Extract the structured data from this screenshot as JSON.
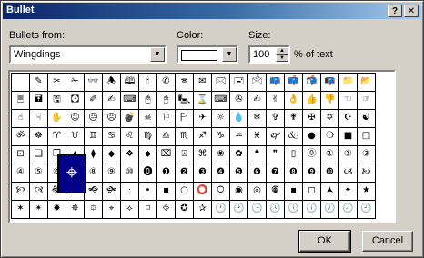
{
  "window": {
    "title": "Bullet",
    "help_label": "?",
    "close_label": "✕"
  },
  "bullets_from": {
    "label": "Bullets from:",
    "value": "Wingdings"
  },
  "color": {
    "label": "Color:"
  },
  "size": {
    "label": "Size:",
    "value": "100",
    "suffix": "% of text"
  },
  "grid": {
    "selected_symbol": "⌖",
    "rows": [
      [
        "",
        "✎",
        "✂",
        "✁",
        "👓",
        "🕭",
        "🕮",
        "🕯",
        "✆",
        "🕿",
        "✉",
        "🖂",
        "🖃",
        "🖄",
        "📪",
        "📫",
        "📬",
        "📭",
        "📁",
        "📂"
      ],
      [
        "🗏",
        "🖬",
        "🖫",
        "🖸",
        "✐",
        "✍",
        "⌨",
        "🖱",
        "🖰",
        "🖳",
        "⌛",
        "⌨",
        "✇",
        "✍",
        "✌",
        "👌",
        "👍",
        "👎",
        "☜",
        "☞"
      ],
      [
        "☝",
        "☟",
        "✋",
        "☺",
        "😐",
        "☹",
        "💣",
        "☠",
        "⚐",
        "🏱",
        "✈",
        "☼",
        "💧",
        "❄",
        "✞",
        "✟",
        "✠",
        "✡",
        "☪",
        "☯"
      ],
      [
        "ॐ",
        "☸",
        "♈",
        "♉",
        "♊",
        "♋",
        "♌",
        "♍",
        "♎",
        "♏",
        "♐",
        "♑",
        "♒",
        "♓",
        "🙰",
        "🙵",
        "●",
        "❍",
        "■",
        "□"
      ],
      [
        "⊡",
        "❑",
        "❒",
        "⬧",
        "⧫",
        "◆",
        "❖",
        "⬥",
        "⌧",
        "⍓",
        "⌘",
        "❀",
        "✿",
        "❝",
        "❞",
        "▯",
        "⓪",
        "①",
        "②",
        "③"
      ],
      [
        "④",
        "⑤",
        "⑥",
        "⑦",
        "⑧",
        "⑨",
        "⑩",
        "⓿",
        "❶",
        "❷",
        "❸",
        "❹",
        "❺",
        "❻",
        "❼",
        "❽",
        "❾",
        "❿",
        "🙢",
        "🙠"
      ],
      [
        "🙡",
        "🙣",
        "🙞",
        "🙜",
        "🙝",
        "🙟",
        "·",
        "•",
        "▪",
        "○",
        "⭕",
        "🞅",
        "◉",
        "◎",
        "🞋",
        "▪",
        "◻",
        "🟂",
        "✦",
        "★"
      ],
      [
        "✶",
        "✴",
        "✹",
        "✵",
        "⯐",
        "⌖",
        "⟡",
        "⌑",
        "⯑",
        "✪",
        "✰",
        "🕐",
        "🕑",
        "🕒",
        "🕓",
        "🕔",
        "🕕",
        "🕖",
        "🕗",
        "🕘"
      ]
    ]
  },
  "buttons": {
    "ok": "OK",
    "cancel": "Cancel"
  }
}
